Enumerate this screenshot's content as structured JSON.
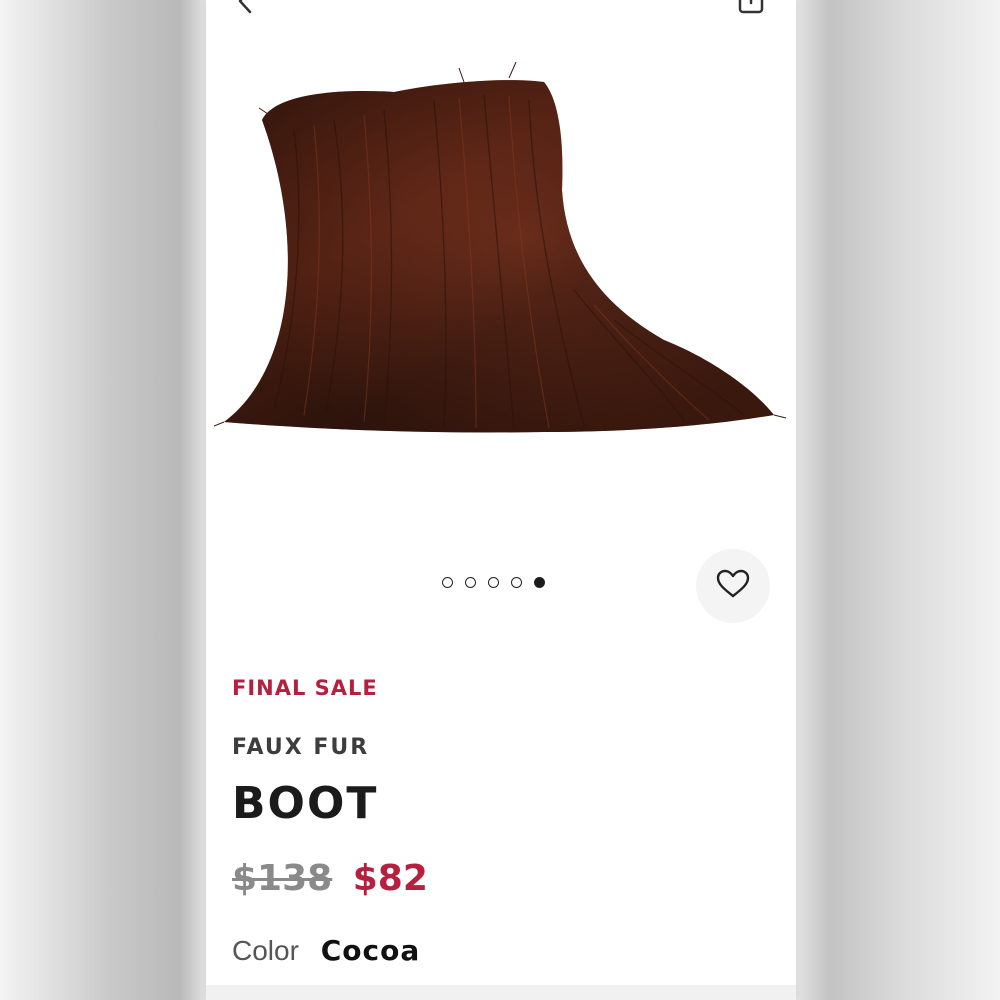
{
  "topbar": {
    "back_icon": "chevron-left-icon",
    "share_icon": "share-icon"
  },
  "gallery": {
    "image": "faux-fur-boot-photo",
    "image_count": 5,
    "active_index": 5
  },
  "wishlist": {
    "icon": "heart-icon"
  },
  "product": {
    "sale_label": "FINAL SALE",
    "subtitle": "FAUX FUR",
    "title": "BOOT",
    "original_price": "$138",
    "sale_price": "$82",
    "color_label": "Color",
    "color_value": "Cocoa"
  },
  "colors": {
    "sale_accent": "#b5203f",
    "fur_dark": "#3a1a10",
    "fur_mid": "#6b2a17"
  }
}
